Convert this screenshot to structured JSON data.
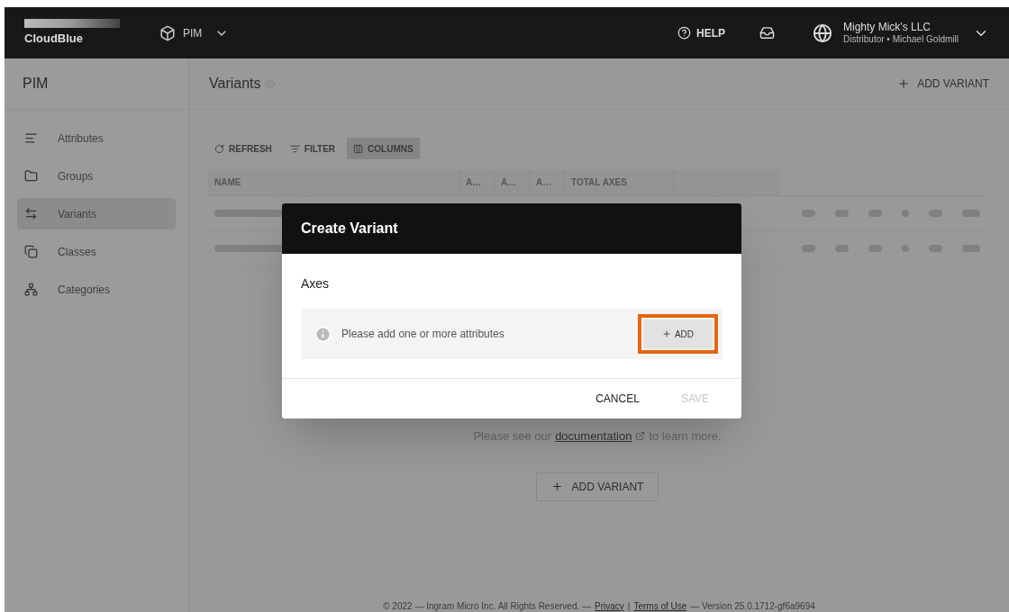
{
  "header": {
    "logo": "CloudBlue",
    "module": "PIM",
    "help": "HELP",
    "account": {
      "name": "Mighty Mick's LLC",
      "role": "Distributor • Michael Goldmill"
    }
  },
  "sidebar": {
    "title": "PIM",
    "items": [
      {
        "label": "Attributes",
        "selected": false
      },
      {
        "label": "Groups",
        "selected": false
      },
      {
        "label": "Variants",
        "selected": true
      },
      {
        "label": "Classes",
        "selected": false
      },
      {
        "label": "Categories",
        "selected": false
      }
    ]
  },
  "page": {
    "title": "Variants",
    "add_button": "ADD VARIANT"
  },
  "toolbar": [
    {
      "label": "REFRESH",
      "selected": false
    },
    {
      "label": "FILTER",
      "selected": false
    },
    {
      "label": "COLUMNS",
      "selected": true
    }
  ],
  "table": {
    "columns": [
      "NAME",
      "A…",
      "A…",
      "A…",
      "TOTAL AXES"
    ]
  },
  "empty_state": {
    "before": "Please see our",
    "link": "documentation",
    "after": "to learn more.",
    "button": "ADD VARIANT"
  },
  "dialog": {
    "title": "Create Variant",
    "section": "Axes",
    "message": "Please add one or more attributes",
    "add": "ADD",
    "cancel": {
      "label": "CANCEL",
      "disabled": false
    },
    "save": {
      "label": "SAVE",
      "disabled": true
    }
  },
  "footer": {
    "copyright": "© 2022 — Ingram Micro Inc. All Rights Reserved. —",
    "privacy": "Privacy",
    "separator": "|",
    "terms": "Terms of Use",
    "version": "— Version 25.0.1712-gf6a9694"
  }
}
